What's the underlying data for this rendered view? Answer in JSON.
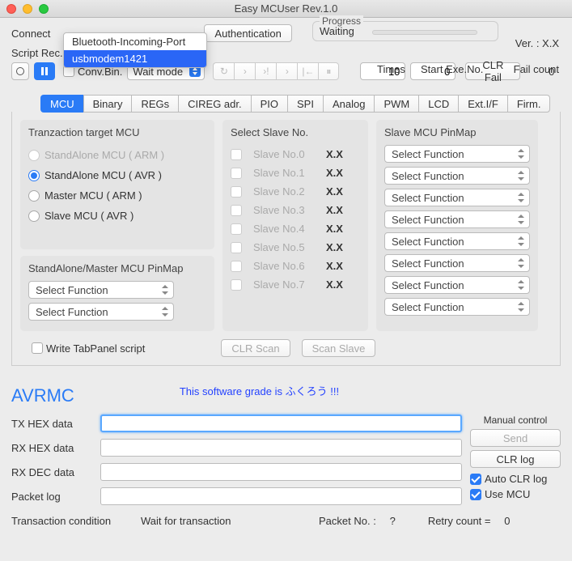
{
  "window": {
    "title": "Easy MCUser Rev.1.0"
  },
  "top": {
    "connect_label": "Connect",
    "auth_label": "Authentication",
    "progress_label": "Progress",
    "progress_status": "Waiting",
    "version_label": "Ver. : X.X",
    "script_label": "Script Rec. / Play cont.",
    "dropdown": {
      "item0": "Bluetooth-Incoming-Port",
      "item1": "usbmodem1421"
    }
  },
  "ctrl": {
    "convbin_label": "Conv.Bin.",
    "waitmode_label": "Wait mode",
    "times_label": "Times",
    "startexe_label": "Start Exe.No.",
    "failcount_label": "Fail count",
    "times_val": "10",
    "startexe_val": "0",
    "clrfail_label": "CLR Fail",
    "failcount_val": "0"
  },
  "tabs": {
    "t0": "MCU",
    "t1": "Binary",
    "t2": "REGs",
    "t3": "CIREG adr.",
    "t4": "PIO",
    "t5": "SPI",
    "t6": "Analog",
    "t7": "PWM",
    "t8": "LCD",
    "t9": "Ext.I/F",
    "t10": "Firm."
  },
  "mcu": {
    "target_title": "Tranzaction target MCU",
    "r0": "StandAlone MCU ( ARM )",
    "r1": "StandAlone MCU ( AVR )",
    "r2": "Master MCU ( ARM )",
    "r3": "Slave MCU ( AVR )",
    "pinmap_title": "StandAlone/Master MCU PinMap",
    "selfunc": "Select Function",
    "slave_title": "Select Slave No.",
    "s0": "Slave No.0",
    "s1": "Slave No.1",
    "s2": "Slave No.2",
    "s3": "Slave No.3",
    "s4": "Slave No.4",
    "s5": "Slave No.5",
    "s6": "Slave No.6",
    "s7": "Slave No.7",
    "sval": "X.X",
    "slavepin_title": "Slave MCU PinMap",
    "write_tab": "Write TabPanel script",
    "clrscan": "CLR Scan",
    "scanslave": "Scan Slave"
  },
  "mid": {
    "avrmc": "AVRMC",
    "grade": "This software grade is ふくろう !!!"
  },
  "lower": {
    "txhex": "TX HEX data",
    "rxhex": "RX HEX data",
    "rxdec": "RX DEC data",
    "pktlog": "Packet log",
    "manual_title": "Manual control",
    "send": "Send",
    "clrlog": "CLR log",
    "autoclr": "Auto CLR log",
    "usemcu": "Use MCU",
    "transcond": "Transaction condition",
    "waitfor": "Wait for transaction",
    "pktno_lbl": "Packet No. :",
    "pktno_val": "?",
    "retry_lbl": "Retry count  =",
    "retry_val": "0"
  }
}
